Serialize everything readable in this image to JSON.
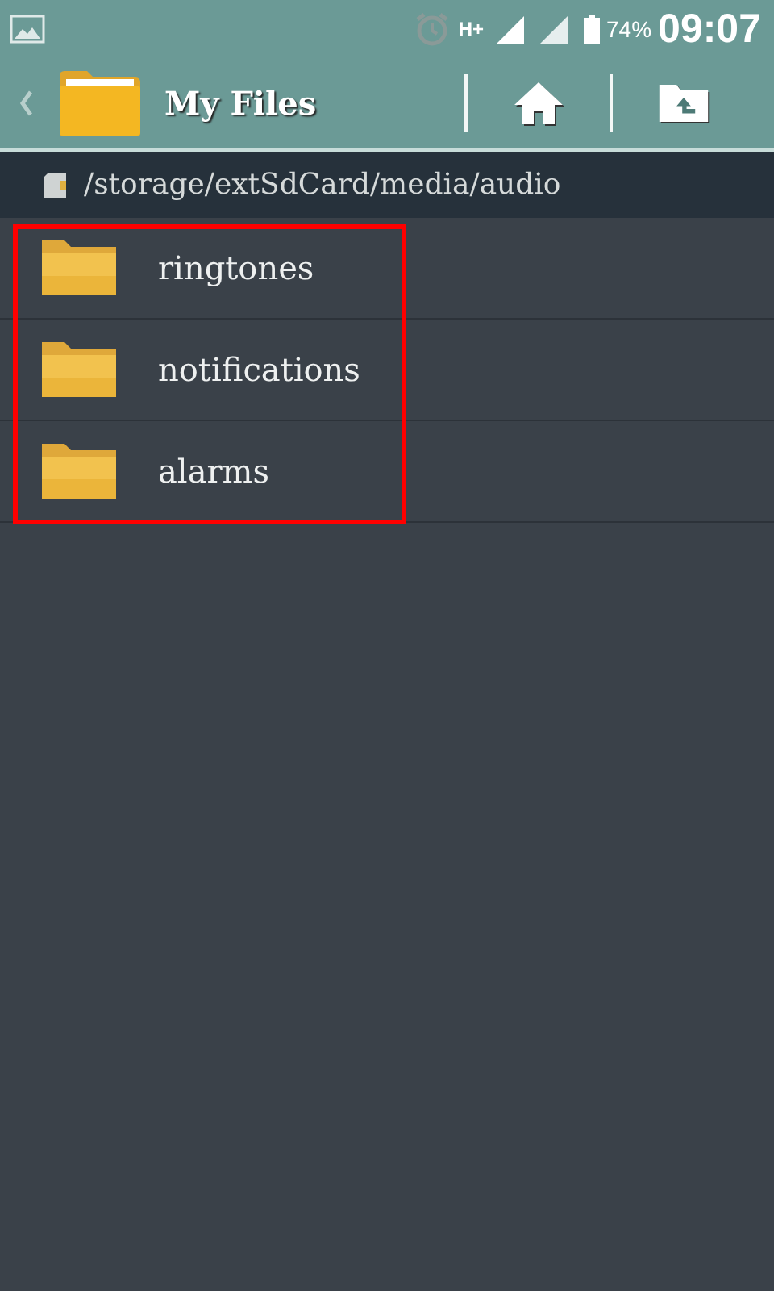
{
  "status_bar": {
    "battery": "74%",
    "time": "09:07",
    "network": "H+"
  },
  "action_bar": {
    "title": "My Files"
  },
  "path_bar": {
    "path": "/storage/extSdCard/media/audio"
  },
  "folders_highlighted": true,
  "folders": [
    {
      "name": "ringtones"
    },
    {
      "name": "notifications"
    },
    {
      "name": "alarms"
    }
  ]
}
